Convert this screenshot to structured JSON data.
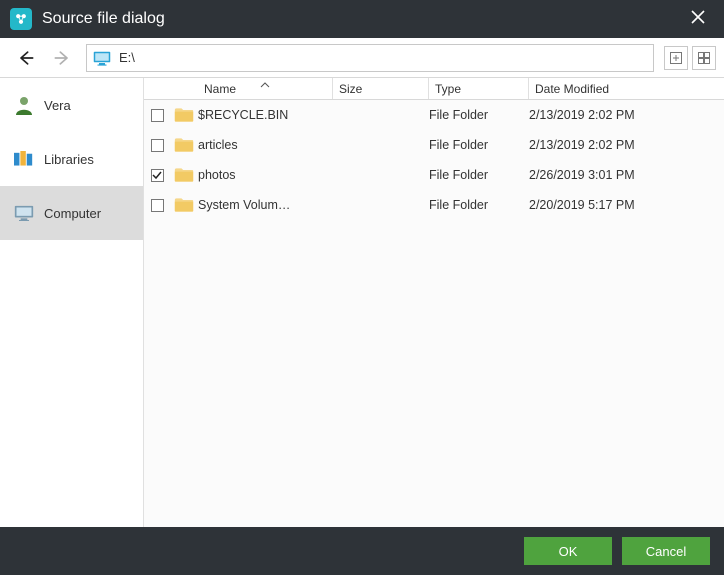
{
  "titlebar": {
    "title": "Source file dialog"
  },
  "toolbar": {
    "path": "E:\\"
  },
  "sidebar": {
    "items": [
      {
        "label": "Vera",
        "icon": "user"
      },
      {
        "label": "Libraries",
        "icon": "libraries"
      },
      {
        "label": "Computer",
        "icon": "monitor"
      }
    ],
    "selectedIndex": 2
  },
  "columns": {
    "name": "Name",
    "size": "Size",
    "type": "Type",
    "date": "Date Modified",
    "sortColumn": "name",
    "sortAsc": true
  },
  "rows": [
    {
      "name": "$RECYCLE.BIN",
      "size": "",
      "type": "File Folder",
      "date": "2/13/2019 2:02 PM",
      "checked": false
    },
    {
      "name": "articles",
      "size": "",
      "type": "File Folder",
      "date": "2/13/2019 2:02 PM",
      "checked": false
    },
    {
      "name": "photos",
      "size": "",
      "type": "File Folder",
      "date": "2/26/2019 3:01 PM",
      "checked": true
    },
    {
      "name": "System Volum…",
      "size": "",
      "type": "File Folder",
      "date": "2/20/2019 5:17 PM",
      "checked": false
    }
  ],
  "footer": {
    "ok": "OK",
    "cancel": "Cancel"
  }
}
